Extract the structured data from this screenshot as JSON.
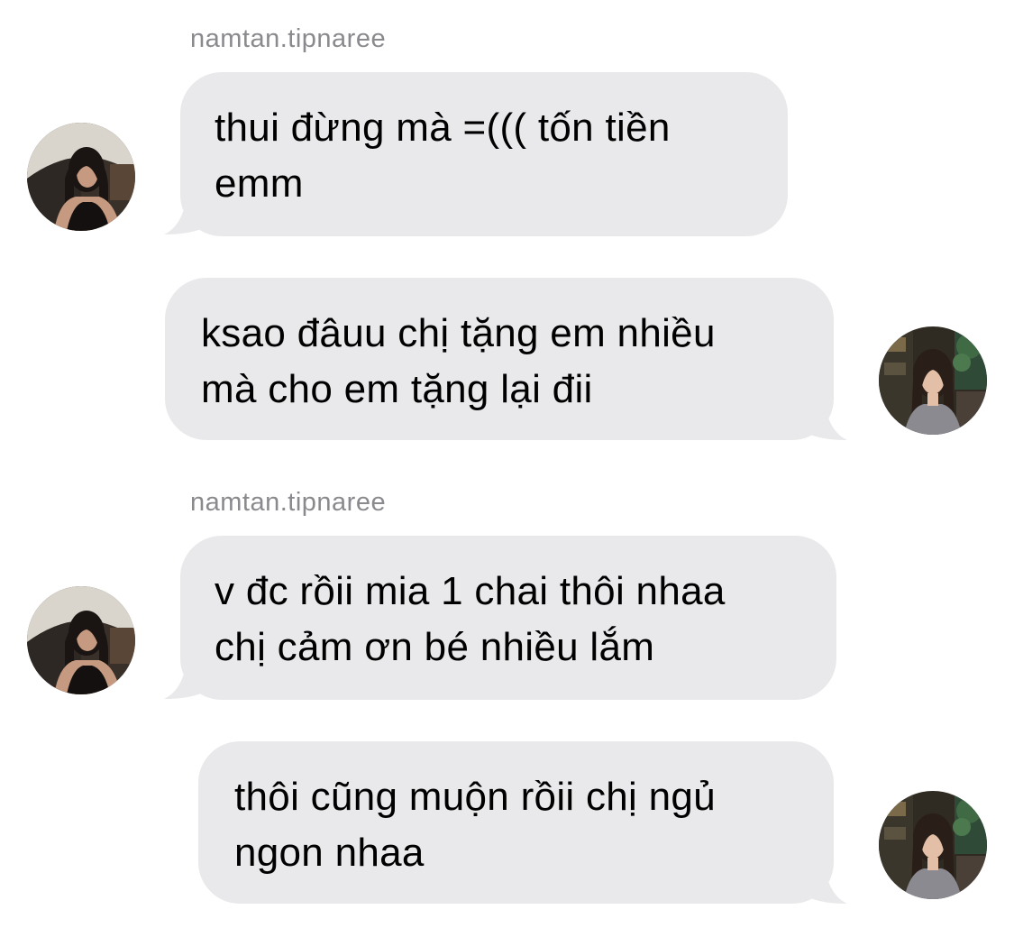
{
  "conversation": {
    "messages": [
      {
        "sender_label": "namtan.tipnaree",
        "direction": "incoming",
        "text": "thui đừng mà =((( tốn tiền\nemm"
      },
      {
        "direction": "outgoing",
        "text": "ksao đâuu chị tặng em nhiều\nmà cho em tặng lại đii"
      },
      {
        "sender_label": "namtan.tipnaree",
        "direction": "incoming",
        "text": "v đc rồii mia 1 chai thôi nhaa\nchị cảm ơn bé nhiều lắm"
      },
      {
        "direction": "outgoing",
        "text": "thôi cũng muộn rồii chị ngủ\nngon nhaa"
      }
    ]
  },
  "colors": {
    "bubble": "#e9e9eb",
    "sender_label": "#8a8a8e",
    "text": "#000000"
  }
}
